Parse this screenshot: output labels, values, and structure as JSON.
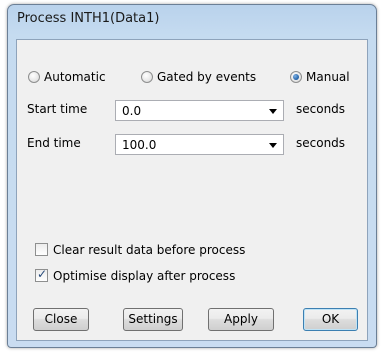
{
  "window": {
    "title": "Process INTH1(Data1)"
  },
  "mode": {
    "options": [
      {
        "label": "Automatic",
        "selected": false
      },
      {
        "label": "Gated by events",
        "selected": false
      },
      {
        "label": "Manual",
        "selected": true
      }
    ]
  },
  "start": {
    "label": "Start time",
    "value": "0.0",
    "unit": "seconds"
  },
  "end": {
    "label": "End time",
    "value": "100.0",
    "unit": "seconds"
  },
  "options": {
    "clear_result": {
      "label": "Clear result data before process",
      "checked": false
    },
    "optimise_display": {
      "label": "Optimise display after process",
      "checked": true
    }
  },
  "buttons": {
    "close": "Close",
    "settings": "Settings",
    "apply": "Apply",
    "ok": "OK"
  },
  "colors": {
    "title_bar": "#c5dbf0",
    "client_bg": "#f0f0f0",
    "radio_selected": "#1f5fa5"
  }
}
